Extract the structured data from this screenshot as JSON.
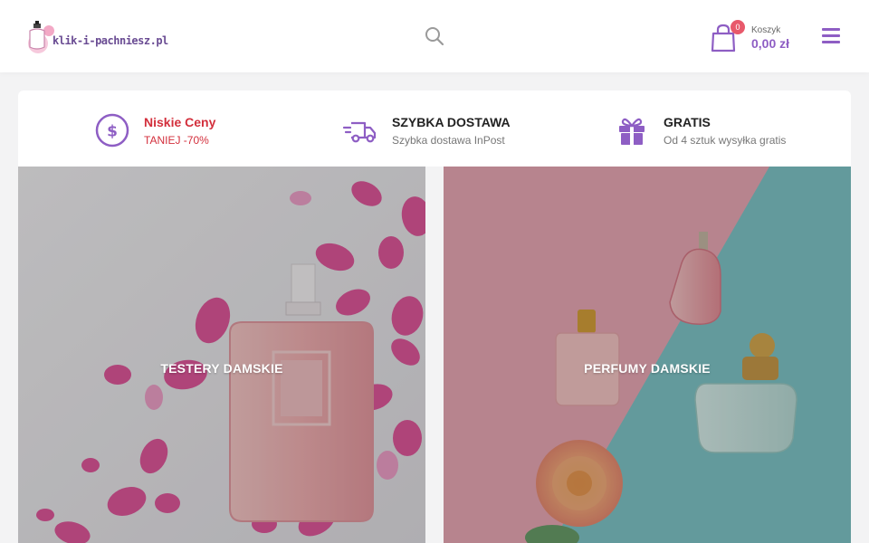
{
  "header": {
    "logo_text": "klik-i-pachniesz.pl",
    "cart": {
      "label": "Koszyk",
      "total": "0,00 zł",
      "count": "0"
    }
  },
  "features": [
    {
      "title": "Niskie Ceny",
      "subtitle": "TANIEJ -70%",
      "icon": "dollar-circle-icon"
    },
    {
      "title": "SZYBKA DOSTAWA",
      "subtitle": "Szybka dostawa InPost",
      "icon": "truck-icon"
    },
    {
      "title": "GRATIS",
      "subtitle": "Od 4 sztuk wysyłka gratis",
      "icon": "gift-icon"
    }
  ],
  "categories": [
    {
      "label": "TESTERY DAMSKIE"
    },
    {
      "label": "PERFUMY DAMSKIE"
    }
  ],
  "colors": {
    "accent": "#8e5ec4",
    "highlight_red": "#d32f3c",
    "badge": "#e8596b"
  }
}
